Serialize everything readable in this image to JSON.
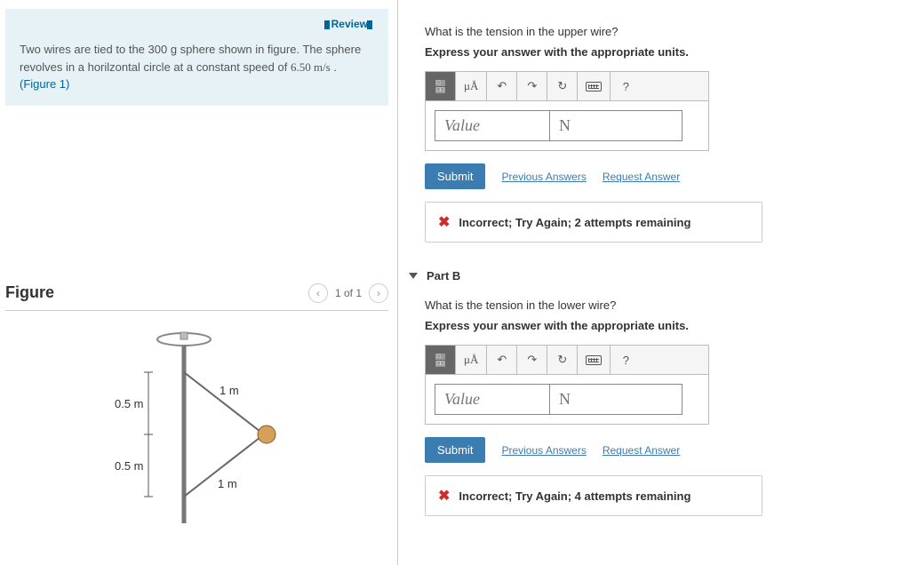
{
  "problem": {
    "review_label": "Review",
    "text_before_speed": "Two wires are tied to the 300 g sphere shown in figure. The sphere revolves in a horilzontal circle at a constant speed of ",
    "speed": "6.50 m/s",
    "text_after_speed": " .",
    "figure_ref": "(Figure 1)"
  },
  "figure": {
    "title": "Figure",
    "counter": "1 of 1",
    "labels": {
      "top": "0.5 m",
      "bottom": "0.5 m",
      "wire": "1 m"
    }
  },
  "partA": {
    "question": "What is the tension in the upper wire?",
    "instruction": "Express your answer with the appropriate units.",
    "value_placeholder": "Value",
    "unit_placeholder": "N",
    "submit": "Submit",
    "prev": "Previous Answers",
    "request": "Request Answer",
    "feedback": "Incorrect; Try Again; 2 attempts remaining",
    "toolbar_ua": "μÅ",
    "toolbar_help": "?"
  },
  "partB": {
    "header": "Part B",
    "question": "What is the tension in the lower wire?",
    "instruction": "Express your answer with the appropriate units.",
    "value_placeholder": "Value",
    "unit_placeholder": "N",
    "submit": "Submit",
    "prev": "Previous Answers",
    "request": "Request Answer",
    "feedback": "Incorrect; Try Again; 4 attempts remaining",
    "toolbar_ua": "μÅ",
    "toolbar_help": "?"
  }
}
